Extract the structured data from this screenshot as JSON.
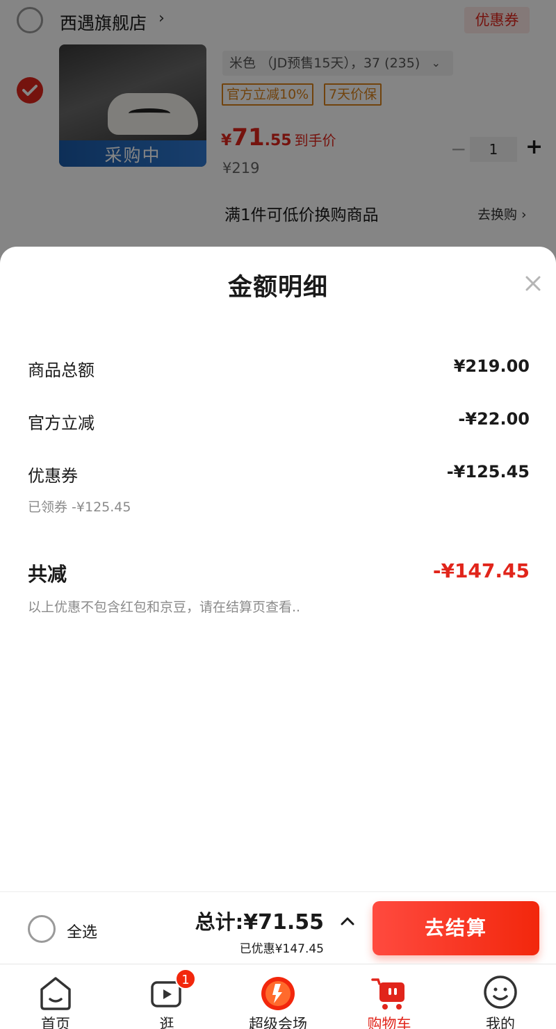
{
  "cart": {
    "store_name": "西遇旗舰店",
    "store_arrow": "›",
    "coupon_button": "优惠券",
    "item": {
      "image_badge": "采购中",
      "variant": "米色 （JD预售15天），37 (235)",
      "variant_chevron": "⌄",
      "tags": [
        "官方立减10%",
        "7天价保"
      ],
      "price_currency": "¥",
      "price_integer": "71",
      "price_decimal": ".55",
      "price_label": "到手价",
      "original_price": "¥219",
      "quantity": "1",
      "qty_minus": "−",
      "qty_plus": "+"
    },
    "promo_text": "满1件可低价换购商品",
    "promo_link": "去换购 ›"
  },
  "sheet": {
    "title": "金额明细",
    "rows": [
      {
        "label": "商品总额",
        "value": "¥219.00"
      },
      {
        "label": "官方立减",
        "value": "-¥22.00"
      },
      {
        "label": "优惠券",
        "value": "-¥125.45",
        "sub": "已领券 -¥125.45"
      }
    ],
    "total_label": "共减",
    "total_value": "-¥147.45",
    "footnote": "以上优惠不包含红包和京豆，请在结算页查看.."
  },
  "checkout": {
    "select_all": "全选",
    "total_prefix": "总计:",
    "total_amount": "¥71.55",
    "saved": "已优惠¥147.45",
    "button": "去结算"
  },
  "tabbar": {
    "items": [
      {
        "label": "首页",
        "icon": "home-icon"
      },
      {
        "label": "逛",
        "icon": "video-icon",
        "badge": "1"
      },
      {
        "label": "超级会场",
        "icon": "super-venue-icon"
      },
      {
        "label": "购物车",
        "icon": "cart-icon",
        "active": true
      },
      {
        "label": "我的",
        "icon": "profile-icon"
      }
    ]
  },
  "colors": {
    "accent": "#e1251b",
    "tag_orange": "#d9801a"
  }
}
